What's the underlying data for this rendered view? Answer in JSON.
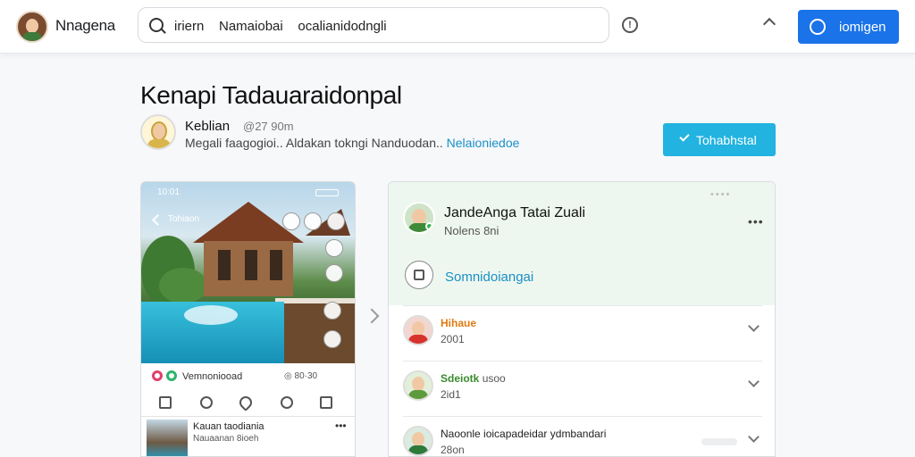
{
  "header": {
    "brand": "Nnagena",
    "search_value": "iriern    Namaiobai    ocalianidodngli",
    "login_label": "iomigen"
  },
  "page": {
    "title": "Kenapi Tadauaraidonpal"
  },
  "author": {
    "name": "Keblian",
    "handle": "@27 90m",
    "description": "Megali faagogioi.. Aldakan tokngi Nanduodan.. ",
    "link": "Nelaioniedoe",
    "install_label": "Tohabhstal"
  },
  "post_preview": {
    "time": "10:01",
    "back_label": "Tohiaon",
    "account": "Vemnoniooad",
    "stats": "◎ 80·30",
    "caption_title": "Kauan taodiania",
    "caption_sub": "Nauaanan 8ioeh"
  },
  "comments_panel": {
    "title": "JandeAnga Tatai Zuali",
    "subtitle": "Nolens 8ni",
    "community_label": "Somnidoiangai",
    "comments": [
      {
        "name": "Hihaue",
        "meta": "2001",
        "name_color": "#e07a10",
        "avatar_color": "#d8322c"
      },
      {
        "name": "Sdeiotk",
        "name_suffix": "usoo",
        "meta": "2id1",
        "name_color": "#3a8a2e",
        "avatar_color": "#5c9a3c"
      },
      {
        "name": "Naoonle",
        "name_suffix": "ioicapadeidar ydmbandari",
        "meta": "28on",
        "name_color": "#222",
        "avatar_color": "#2d7a3a"
      }
    ]
  }
}
